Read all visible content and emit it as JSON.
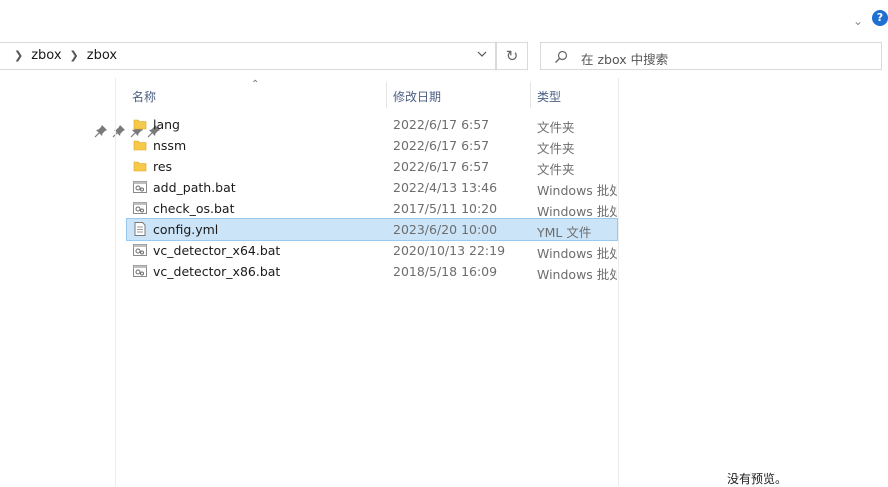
{
  "address": {
    "breadcrumbs": [
      "zbox",
      "zbox"
    ]
  },
  "search": {
    "placeholder": "在 zbox 中搜索"
  },
  "columns": {
    "name": "名称",
    "date": "修改日期",
    "type": "类型"
  },
  "files": [
    {
      "name": "lang",
      "date": "2022/6/17 6:57",
      "type": "文件夹",
      "icon": "folder-icon"
    },
    {
      "name": "nssm",
      "date": "2022/6/17 6:57",
      "type": "文件夹",
      "icon": "folder-icon"
    },
    {
      "name": "res",
      "date": "2022/6/17 6:57",
      "type": "文件夹",
      "icon": "folder-icon"
    },
    {
      "name": "add_path.bat",
      "date": "2022/4/13 13:46",
      "type": "Windows 批处",
      "icon": "batch-file-icon"
    },
    {
      "name": "check_os.bat",
      "date": "2017/5/11 10:20",
      "type": "Windows 批处",
      "icon": "batch-file-icon"
    },
    {
      "name": "config.yml",
      "date": "2023/6/20 10:00",
      "type": "YML 文件",
      "icon": "text-file-icon",
      "selected": true
    },
    {
      "name": "vc_detector_x64.bat",
      "date": "2020/10/13 22:19",
      "type": "Windows 批处",
      "icon": "batch-file-icon"
    },
    {
      "name": "vc_detector_x86.bat",
      "date": "2018/5/18 16:09",
      "type": "Windows 批处",
      "icon": "batch-file-icon"
    }
  ],
  "preview": {
    "message": "没有预览。"
  },
  "colors": {
    "selected_bg": "#cce4f7",
    "folder": "#f7c948",
    "help": "#1e6fcf"
  }
}
